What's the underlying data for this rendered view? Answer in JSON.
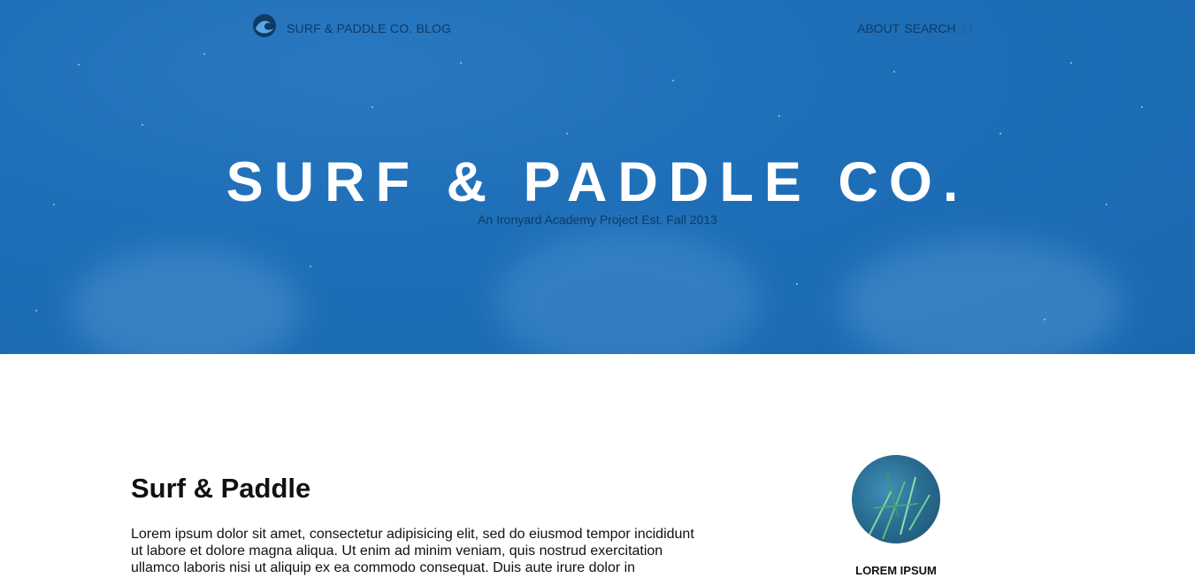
{
  "nav": {
    "brand": "SURF & PADDLE CO. BLOG",
    "about": "ABOUT",
    "search": "SEARCH",
    "logo_icon": "wave-logo-icon",
    "search_icon": "search-box-icon"
  },
  "hero": {
    "title": "SURF & PADDLE CO.",
    "subtitle": "An Ironyard Academy Project Est. Fall 2013"
  },
  "post": {
    "title": "Surf & Paddle",
    "body": "Lorem ipsum dolor sit amet, consectetur adipisicing elit, sed do eiusmod tempor incididunt ut labore et dolore magna aliqua. Ut enim ad minim veniam, quis nostrud exercitation ullamco laboris nisi ut aliquip ex ea commodo consequat. Duis aute irure dolor in"
  },
  "sidebar": {
    "label": "LOREM IPSUM"
  },
  "colors": {
    "hero_blue": "#1e6fb8",
    "nav_text": "#0f3a64",
    "hero_title": "#ffffff"
  }
}
